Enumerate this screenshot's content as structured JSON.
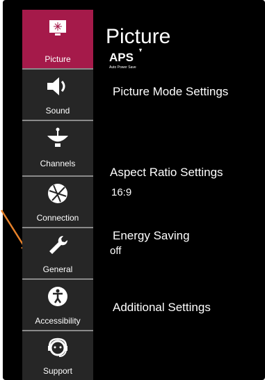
{
  "sidebar": {
    "items": [
      {
        "label": "Picture",
        "icon": "picture-icon"
      },
      {
        "label": "Sound",
        "icon": "speaker-icon"
      },
      {
        "label": "Channels",
        "icon": "satellite-dish-icon"
      },
      {
        "label": "Connection",
        "icon": "globe-icon"
      },
      {
        "label": "General",
        "icon": "wrench-icon"
      },
      {
        "label": "Accessibility",
        "icon": "accessibility-icon"
      },
      {
        "label": "Support",
        "icon": "headset-icon"
      }
    ]
  },
  "main": {
    "title": "Picture",
    "aps_logo_text": "APS",
    "aps_caption": "Auto Power Save",
    "settings": [
      {
        "title": "Picture Mode Settings",
        "value": ""
      },
      {
        "title": "Aspect Ratio Settings",
        "value": "16:9"
      },
      {
        "title": "Energy Saving",
        "value": "off"
      },
      {
        "title": "Additional Settings",
        "value": ""
      }
    ]
  },
  "colors": {
    "active_tab": "#a51a4a",
    "tab_background": "#262626",
    "annotation_arrow": "#e8822a"
  }
}
